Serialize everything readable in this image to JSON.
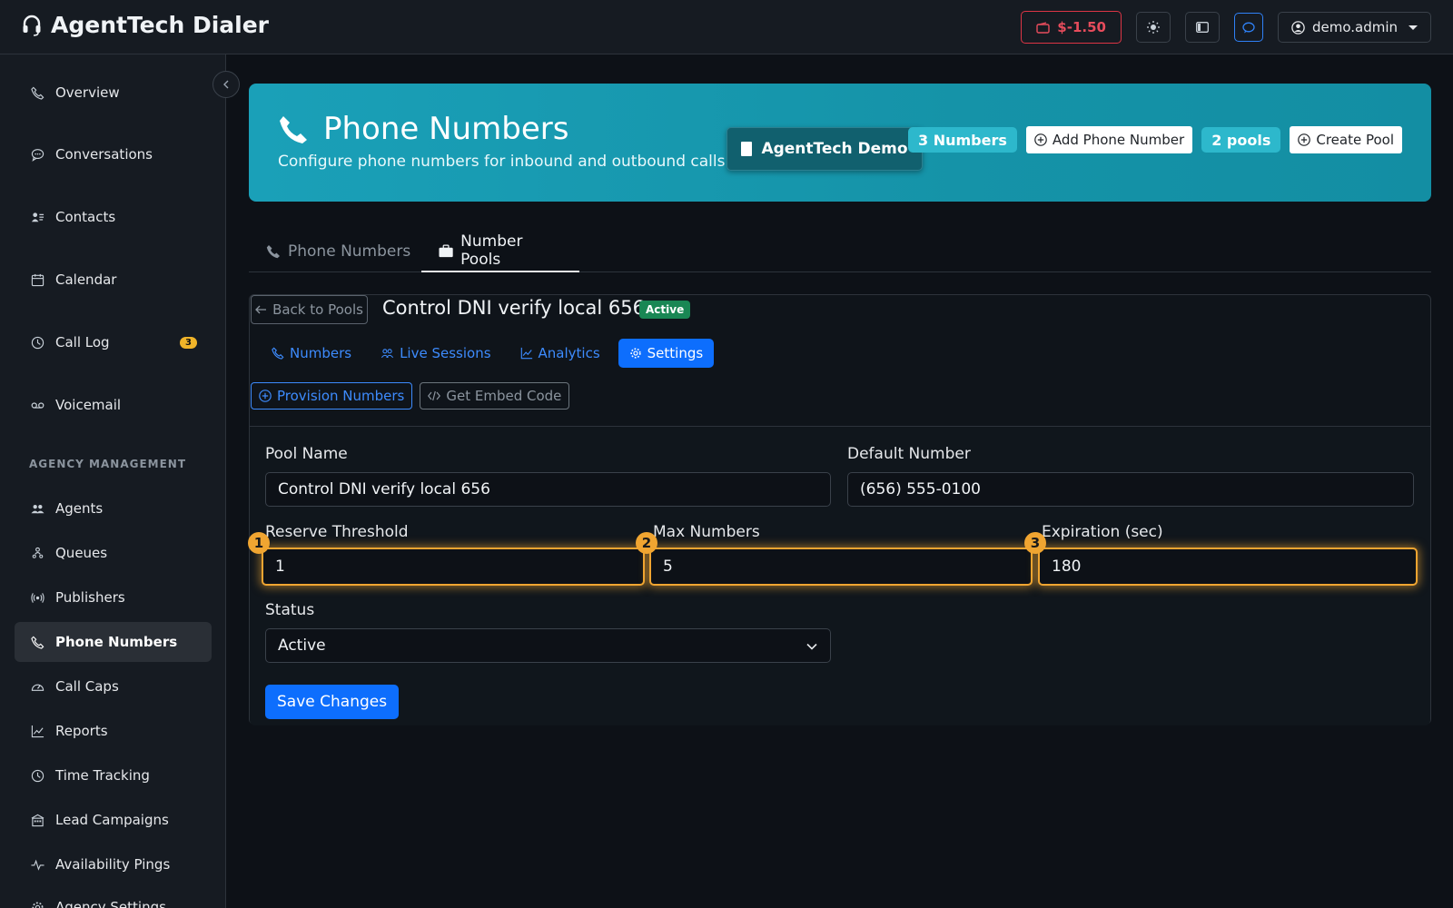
{
  "app": {
    "title": "AgentTech Dialer"
  },
  "topbar": {
    "balance": "$-1.50",
    "user": "demo.admin"
  },
  "sidebar": {
    "section_label": "AGENCY MANAGEMENT",
    "items": [
      {
        "label": "Overview",
        "icon": "phone-icon"
      },
      {
        "label": "Conversations",
        "icon": "chat-icon"
      },
      {
        "label": "Contacts",
        "icon": "contacts-icon"
      },
      {
        "label": "Calendar",
        "icon": "calendar-icon"
      },
      {
        "label": "Call Log",
        "icon": "clock-icon",
        "badge": "3"
      },
      {
        "label": "Voicemail",
        "icon": "voicemail-icon"
      },
      {
        "label": "Agents",
        "icon": "people-icon"
      },
      {
        "label": "Queues",
        "icon": "queue-icon"
      },
      {
        "label": "Publishers",
        "icon": "broadcast-icon"
      },
      {
        "label": "Phone Numbers",
        "icon": "phone-icon",
        "active": true
      },
      {
        "label": "Call Caps",
        "icon": "gauge-icon"
      },
      {
        "label": "Reports",
        "icon": "chart-icon"
      },
      {
        "label": "Time Tracking",
        "icon": "clock-icon"
      },
      {
        "label": "Lead Campaigns",
        "icon": "building-icon"
      },
      {
        "label": "Availability Pings",
        "icon": "pulse-icon"
      },
      {
        "label": "Agency Settings",
        "icon": "gear-icon"
      }
    ]
  },
  "hero": {
    "title": "Phone Numbers",
    "subtitle": "Configure phone numbers for inbound and outbound calls",
    "company": "AgentTech Demo",
    "numbers_count": "3 Numbers",
    "add_number": "Add Phone Number",
    "pools_count": "2 pools",
    "create_pool": "Create Pool"
  },
  "tabs": [
    {
      "label": "Phone Numbers"
    },
    {
      "label": "Number Pools",
      "active": true
    }
  ],
  "pool": {
    "back": "Back to Pools",
    "name": "Control DNI verify local 656",
    "status": "Active",
    "subnav": [
      "Numbers",
      "Live Sessions",
      "Analytics",
      "Settings"
    ],
    "provision": "Provision Numbers",
    "embed": "Get Embed Code"
  },
  "form": {
    "pool_name_label": "Pool Name",
    "pool_name": "Control DNI verify local 656",
    "default_number_label": "Default Number",
    "default_number": "(656) 555-0100",
    "reserve_label": "Reserve Threshold",
    "reserve": "1",
    "max_label": "Max Numbers",
    "max": "5",
    "expiration_label": "Expiration (sec)",
    "expiration": "180",
    "status_label": "Status",
    "status": "Active",
    "save": "Save Changes",
    "markers": [
      "1",
      "2",
      "3"
    ]
  },
  "colors": {
    "accent": "#0d6efd",
    "hero": "#1aa0b8",
    "highlight": "#f0a531",
    "danger": "#dc3545"
  }
}
